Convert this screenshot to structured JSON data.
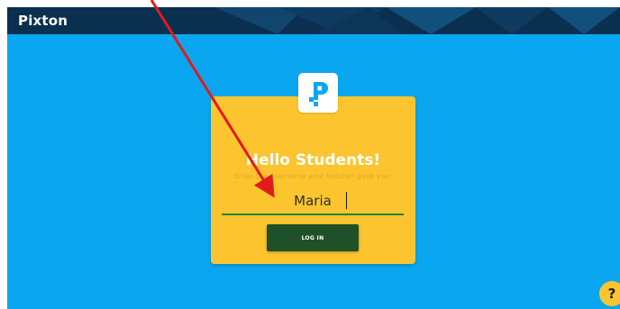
{
  "app": {
    "logo_text": "Pixton"
  },
  "card": {
    "title": "Hello Students!",
    "subtitle": "Enter the username your teacher gave you:",
    "username_value": "Maria",
    "login_label": "LOG IN"
  },
  "help": {
    "label": "?"
  },
  "colors": {
    "page_background": "#0aa7f0",
    "header_background": "#0b2f4f",
    "card_background": "#fcc52f",
    "button_background": "#1f5128",
    "field_underline": "#2b7d3c",
    "annotation_arrow": "#e11b1b"
  },
  "icons": {
    "logo_badge": "pixton-p-logo-icon",
    "annotation": "red-arrow-annotation"
  }
}
